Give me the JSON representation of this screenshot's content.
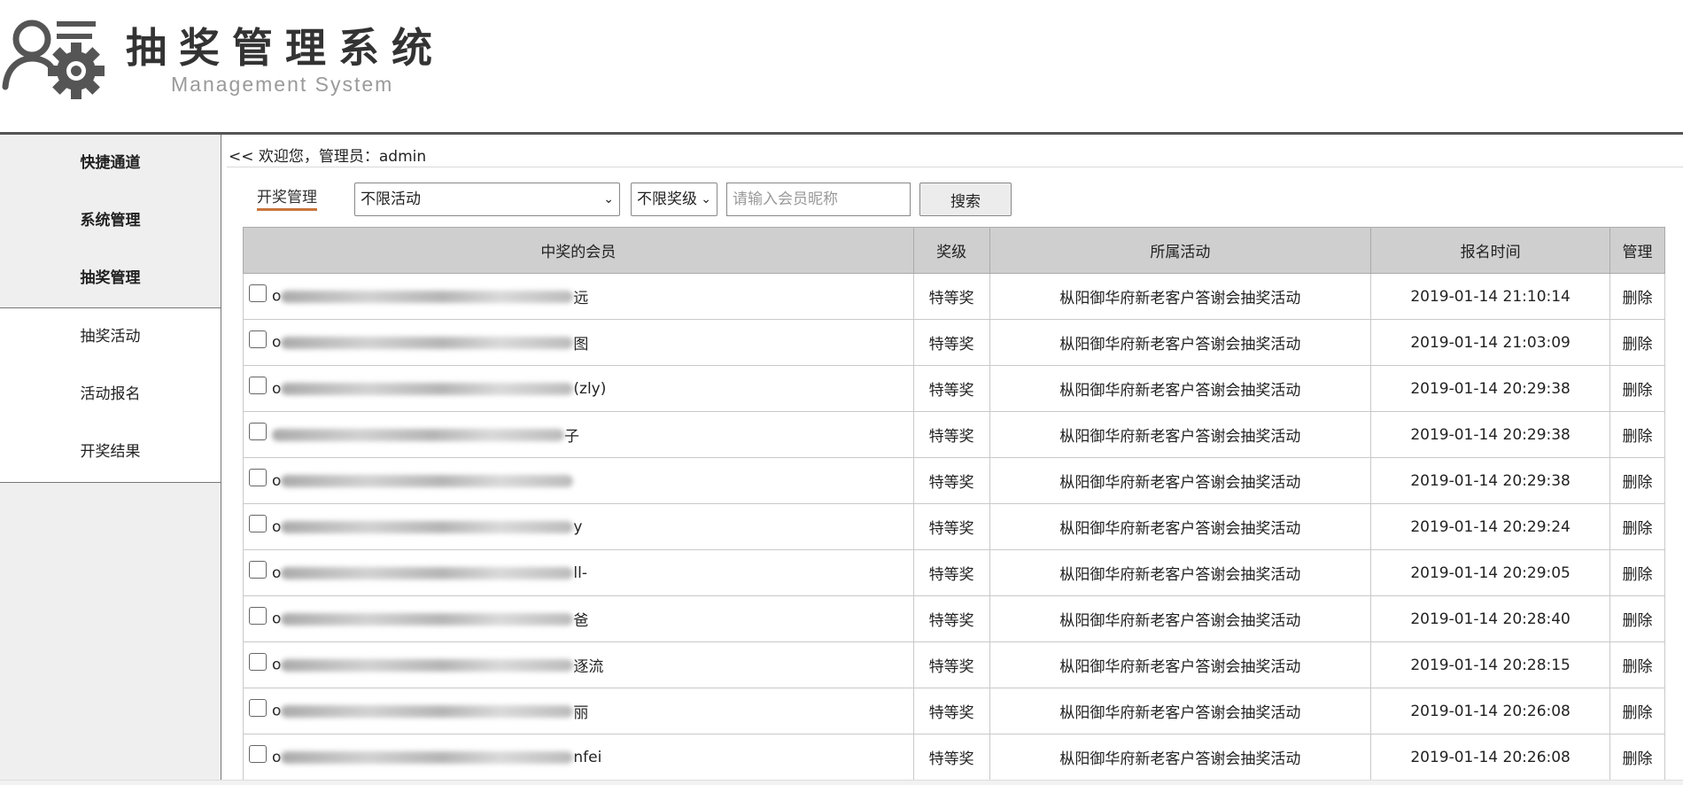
{
  "header": {
    "title": "抽奖管理系统",
    "subtitle": "Management System"
  },
  "sidebar": {
    "groups": [
      {
        "label": "快捷通道"
      },
      {
        "label": "系统管理"
      },
      {
        "label": "抽奖管理"
      }
    ],
    "items": [
      {
        "label": "抽奖活动"
      },
      {
        "label": "活动报名"
      },
      {
        "label": "开奖结果"
      }
    ]
  },
  "main": {
    "welcome": "<< 欢迎您，管理员：admin",
    "section_title": "开奖管理",
    "activity_select": "不限活动",
    "level_select": "不限奖级",
    "search_placeholder": "请输入会员昵称",
    "search_button": "搜索"
  },
  "table": {
    "headers": [
      "中奖的会员",
      "奖级",
      "所属活动",
      "报名时间",
      "管理"
    ],
    "rows": [
      {
        "prefix": "o",
        "suffix": "远",
        "level": "特等奖",
        "activity": "枞阳御华府新老客户答谢会抽奖活动",
        "time": "2019-01-14 21:10:14",
        "action": "删除"
      },
      {
        "prefix": "o",
        "suffix": "图",
        "level": "特等奖",
        "activity": "枞阳御华府新老客户答谢会抽奖活动",
        "time": "2019-01-14 21:03:09",
        "action": "删除"
      },
      {
        "prefix": "o",
        "suffix": "(zly)",
        "level": "特等奖",
        "activity": "枞阳御华府新老客户答谢会抽奖活动",
        "time": "2019-01-14 20:29:38",
        "action": "删除"
      },
      {
        "prefix": "",
        "suffix": "子",
        "level": "特等奖",
        "activity": "枞阳御华府新老客户答谢会抽奖活动",
        "time": "2019-01-14 20:29:38",
        "action": "删除"
      },
      {
        "prefix": "o",
        "suffix": "",
        "level": "特等奖",
        "activity": "枞阳御华府新老客户答谢会抽奖活动",
        "time": "2019-01-14 20:29:38",
        "action": "删除"
      },
      {
        "prefix": "o",
        "suffix": "y",
        "level": "特等奖",
        "activity": "枞阳御华府新老客户答谢会抽奖活动",
        "time": "2019-01-14 20:29:24",
        "action": "删除"
      },
      {
        "prefix": "o",
        "suffix": "ll-",
        "level": "特等奖",
        "activity": "枞阳御华府新老客户答谢会抽奖活动",
        "time": "2019-01-14 20:29:05",
        "action": "删除"
      },
      {
        "prefix": "o",
        "suffix": "爸",
        "level": "特等奖",
        "activity": "枞阳御华府新老客户答谢会抽奖活动",
        "time": "2019-01-14 20:28:40",
        "action": "删除"
      },
      {
        "prefix": "o",
        "suffix": "逐流",
        "level": "特等奖",
        "activity": "枞阳御华府新老客户答谢会抽奖活动",
        "time": "2019-01-14 20:28:15",
        "action": "删除"
      },
      {
        "prefix": "o",
        "suffix": "丽",
        "level": "特等奖",
        "activity": "枞阳御华府新老客户答谢会抽奖活动",
        "time": "2019-01-14 20:26:08",
        "action": "删除"
      },
      {
        "prefix": "o",
        "suffix": "nfei",
        "level": "特等奖",
        "activity": "枞阳御华府新老客户答谢会抽奖活动",
        "time": "2019-01-14 20:26:08",
        "action": "删除"
      }
    ]
  },
  "icons": {
    "logo": "user-gear-icon",
    "dropdown": "chevron-down-icon"
  },
  "colors": {
    "accent_underline": "#c8753c",
    "table_header_bg": "#cfcfcf",
    "sidebar_bg": "#efefef"
  }
}
